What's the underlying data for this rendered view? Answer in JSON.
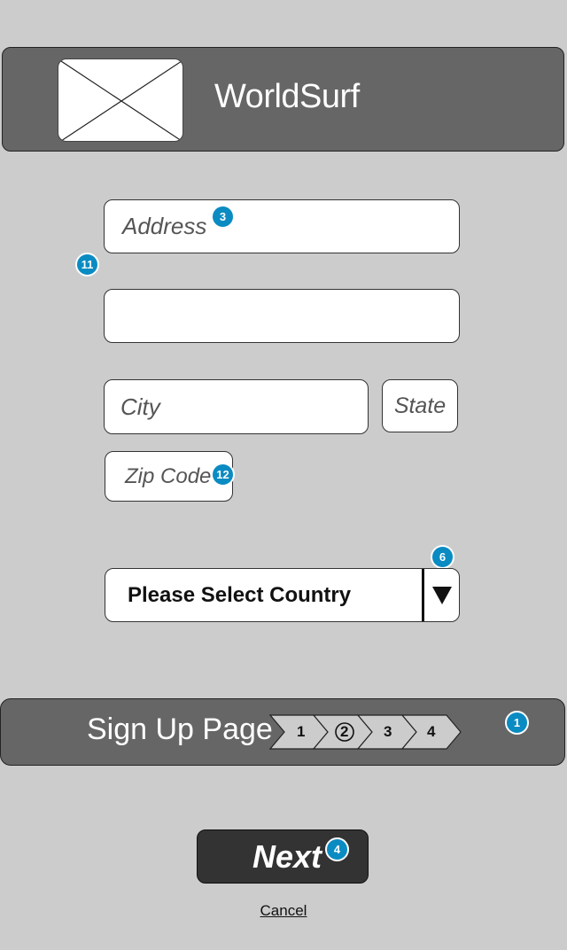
{
  "header": {
    "title": "WorldSurf",
    "logo": "image-placeholder-icon"
  },
  "form": {
    "address_placeholder": "Address",
    "address2_placeholder": "",
    "city_placeholder": "City",
    "state_placeholder": "State",
    "zip_placeholder": "Zip Code",
    "country_select": {
      "selected": "Please Select Country",
      "icon": "dropdown-triangle-icon"
    }
  },
  "progress": {
    "title": "Sign Up Page",
    "steps": [
      "1",
      "2",
      "3",
      "4"
    ],
    "current_step": 2
  },
  "actions": {
    "next_label": "Next",
    "cancel_label": "Cancel"
  },
  "annotations": {
    "address": "3",
    "form_group": "11",
    "zip": "12",
    "country": "6",
    "progress": "1",
    "next": "4"
  },
  "colors": {
    "background": "#cccccc",
    "bar": "#666666",
    "button": "#333333",
    "badge": "#0a8bc2"
  }
}
